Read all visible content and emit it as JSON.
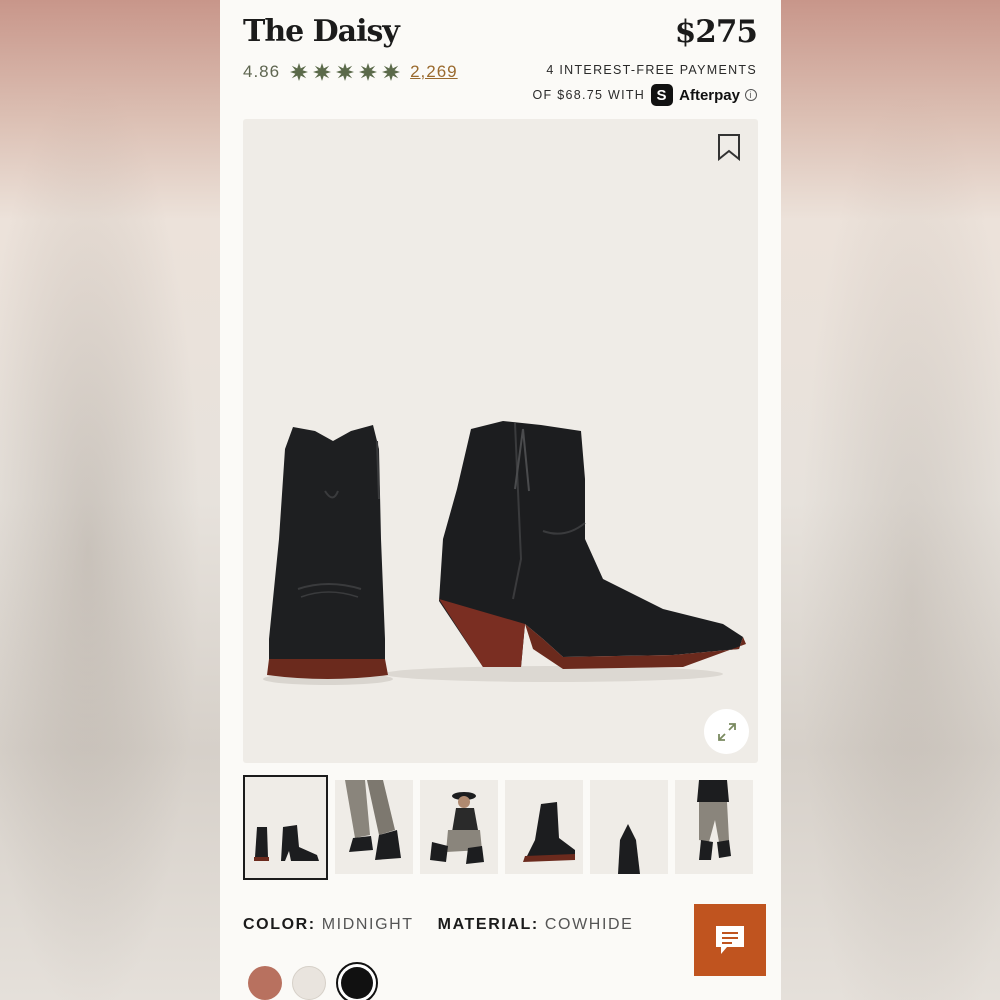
{
  "product": {
    "title": "The Daisy",
    "price": "$275",
    "rating": "4.86",
    "review_count": "2,269"
  },
  "afterpay": {
    "line1": "4 INTEREST-FREE PAYMENTS",
    "line2": "OF $68.75 WITH",
    "brand": "Afterpay",
    "badge": "S"
  },
  "options": {
    "color_label": "COLOR:",
    "color_value": "MIDNIGHT",
    "material_label": "MATERIAL:",
    "material_value": "COWHIDE"
  },
  "colors": {
    "star": "#5b6a4a",
    "accent": "#c0541f",
    "swatches": [
      "#b8715f",
      "#e9e4de",
      "#111111"
    ]
  },
  "icons": {
    "save": "bookmark-icon",
    "expand": "expand-icon",
    "chat": "chat-icon",
    "info": "info-icon"
  }
}
